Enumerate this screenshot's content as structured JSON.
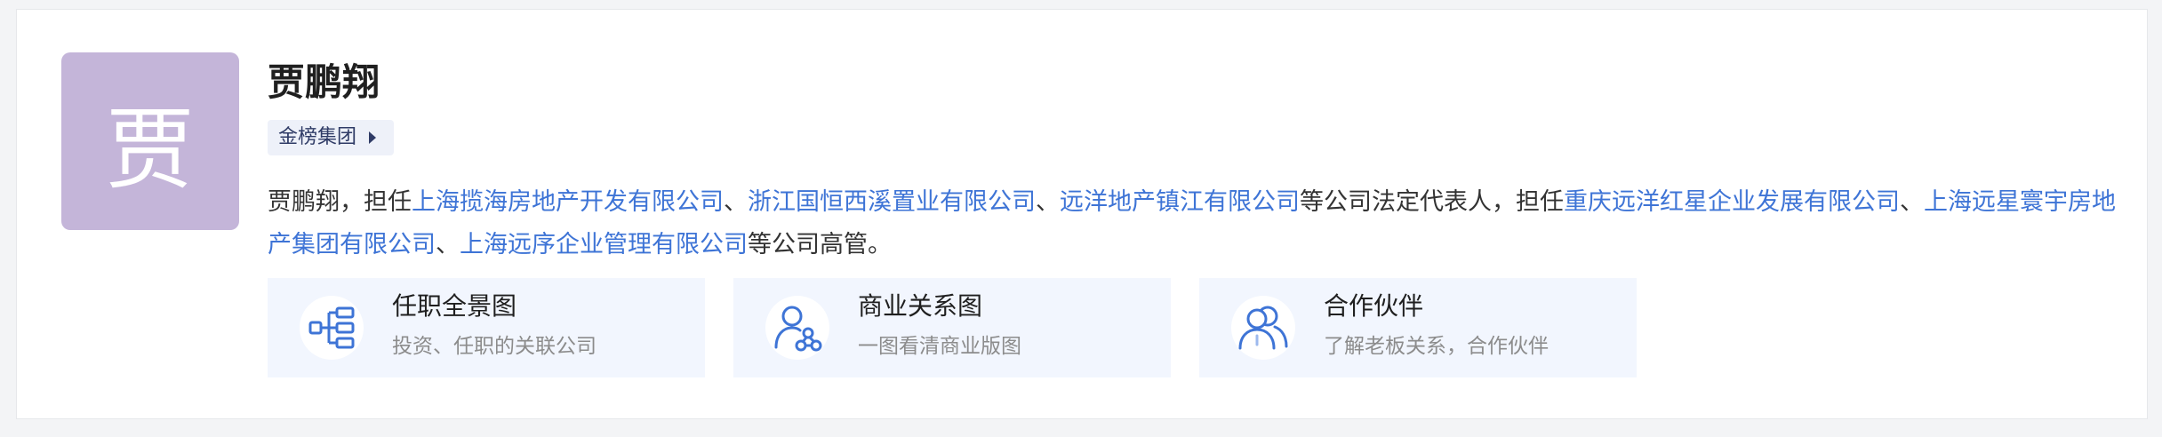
{
  "colors": {
    "avatar_bg": "#c4b5d9",
    "link": "#3e74d6",
    "tag_bg": "#eef1f9",
    "tag_text": "#2f3b66",
    "feature_bg": "#f2f6fe",
    "icon_blue": "#3e74d6"
  },
  "person": {
    "avatar_char": "贾",
    "name": "贾鹏翔",
    "tag_label": "金榜集团"
  },
  "description": {
    "segments": [
      {
        "type": "text",
        "text": "贾鹏翔，担任"
      },
      {
        "type": "link",
        "text": "上海揽海房地产开发有限公司"
      },
      {
        "type": "text",
        "text": "、"
      },
      {
        "type": "link",
        "text": "浙江国恒西溪置业有限公司"
      },
      {
        "type": "text",
        "text": "、"
      },
      {
        "type": "link",
        "text": "远洋地产镇江有限公司"
      },
      {
        "type": "text",
        "text": "等公司法定代表人，担任"
      },
      {
        "type": "link",
        "text": "重庆远洋红星企业发展有限公司"
      },
      {
        "type": "text",
        "text": "、"
      },
      {
        "type": "link",
        "text": "上海远星寰宇房地产集团有限公司"
      },
      {
        "type": "text",
        "text": "、"
      },
      {
        "type": "link",
        "text": "上海远序企业管理有限公司"
      },
      {
        "type": "text",
        "text": "等公司高管。"
      }
    ]
  },
  "features": [
    {
      "icon": "org-tree-icon",
      "title": "任职全景图",
      "subtitle": "投资、任职的关联公司"
    },
    {
      "icon": "person-network-icon",
      "title": "商业关系图",
      "subtitle": "一图看清商业版图"
    },
    {
      "icon": "partners-icon",
      "title": "合作伙伴",
      "subtitle": "了解老板关系，合作伙伴"
    }
  ]
}
